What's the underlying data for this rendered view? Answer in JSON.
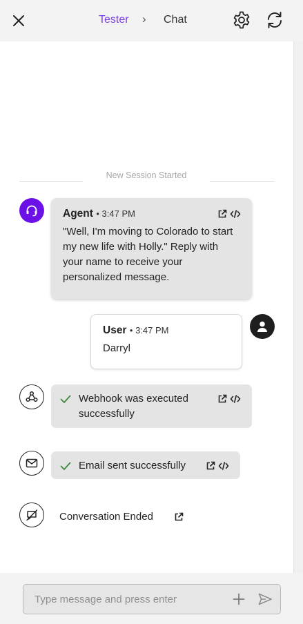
{
  "header": {
    "breadcrumb_parent": "Tester",
    "breadcrumb_separator": "›",
    "breadcrumb_current": "Chat"
  },
  "session": {
    "divider_label": "New Session Started"
  },
  "messages": {
    "agent": {
      "sender": "Agent",
      "time": "• 3:47 PM",
      "text": "\"Well, I'm moving to Colorado to start my new life with Holly.\" Reply with your name to receive your personalized message."
    },
    "user": {
      "sender": "User",
      "time": "• 3:47 PM",
      "text": "Darryl"
    }
  },
  "events": {
    "webhook": {
      "text": "Webhook was executed successfully"
    },
    "email": {
      "text": "Email sent successfully"
    },
    "ended": {
      "text": "Conversation Ended"
    }
  },
  "composer": {
    "placeholder": "Type message and press enter",
    "value": ""
  },
  "colors": {
    "accent": "#7b3fe4",
    "agent_avatar": "#6b11e8",
    "success": "#3c8a3c"
  },
  "icons": {
    "close": "close-icon",
    "settings": "gear-icon",
    "refresh": "refresh-icon",
    "agent": "headset-icon",
    "user": "person-icon",
    "webhook": "webhook-icon",
    "email": "envelope-icon",
    "ended": "chat-off-icon",
    "open": "external-link-icon",
    "code": "code-icon",
    "add": "plus-icon",
    "send": "send-icon"
  }
}
